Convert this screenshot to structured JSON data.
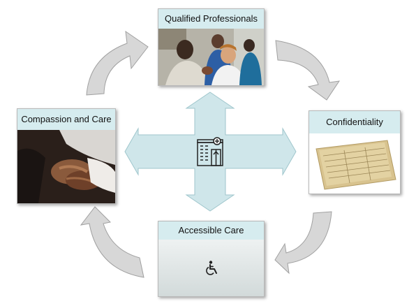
{
  "diagram": {
    "nodes": {
      "top": {
        "label": "Qualified Professionals"
      },
      "left": {
        "label": "Compassion and Care"
      },
      "right": {
        "label": "Confidentiality"
      },
      "bottom": {
        "label": "Accessible Care"
      }
    },
    "center_icon": "hospital-building-icon",
    "bottom_icon": "wheelchair-icon",
    "cycle_direction": "clockwise"
  },
  "colors": {
    "card_header": "#d6ecef",
    "cross_arrow_fill": "#cfe6ea",
    "cross_arrow_stroke": "#9fc6cc",
    "cycle_arrow_fill": "#d7d7d7",
    "cycle_arrow_stroke": "#a0a0a0"
  }
}
